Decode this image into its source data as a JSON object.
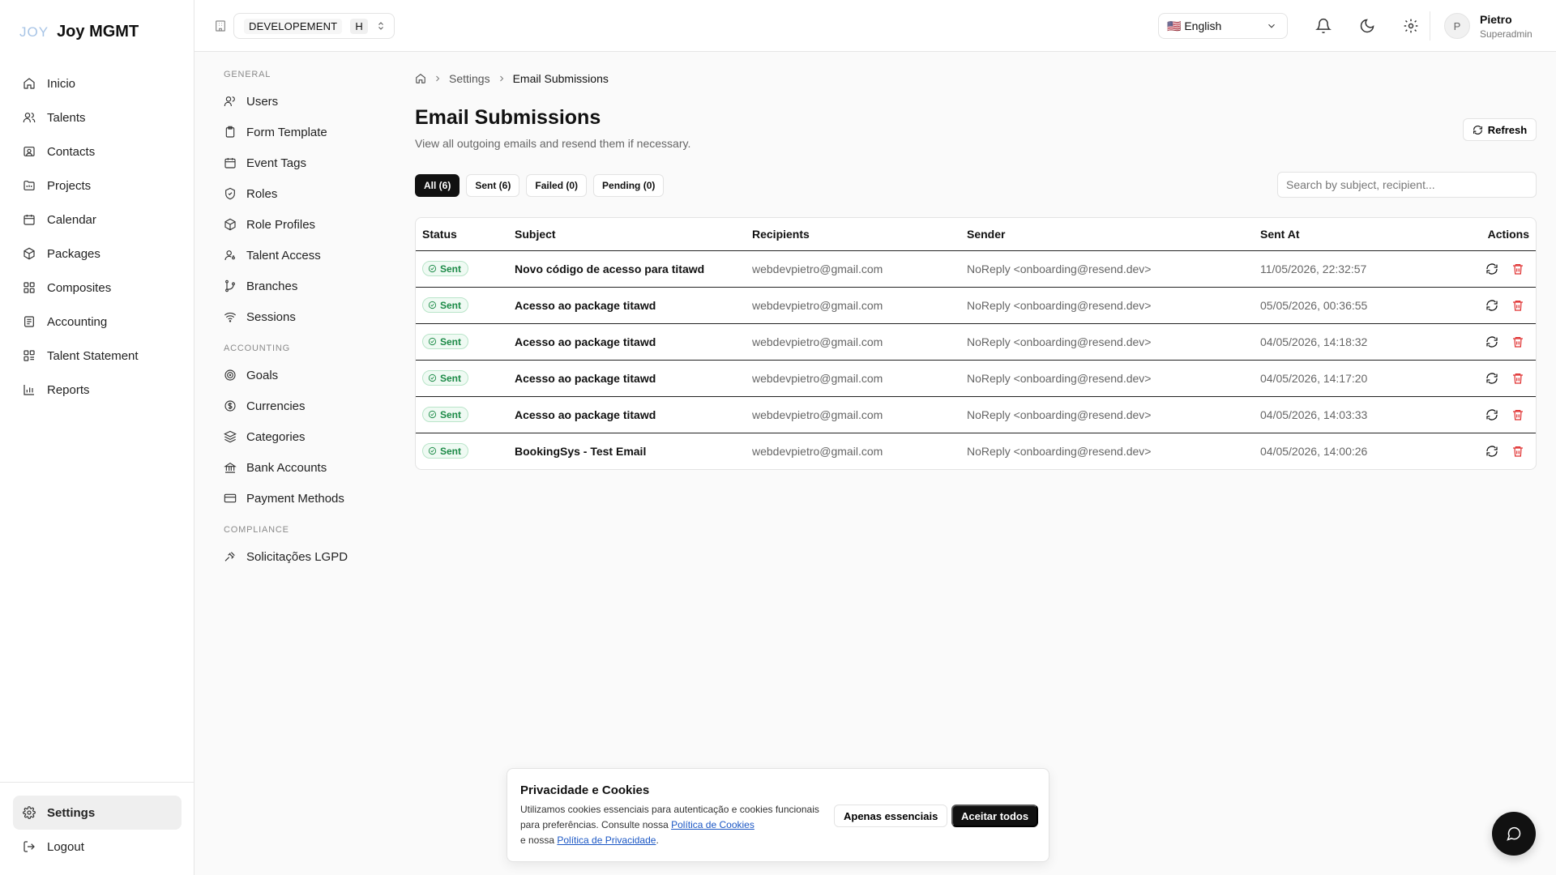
{
  "app": {
    "logo_mark": "JOY",
    "logo_text": "Joy MGMT"
  },
  "nav": {
    "items": [
      {
        "label": "Inicio",
        "icon": "home-icon"
      },
      {
        "label": "Talents",
        "icon": "users-icon"
      },
      {
        "label": "Contacts",
        "icon": "contact-card-icon"
      },
      {
        "label": "Projects",
        "icon": "folder-icon"
      },
      {
        "label": "Calendar",
        "icon": "calendar-icon"
      },
      {
        "label": "Packages",
        "icon": "package-icon"
      },
      {
        "label": "Composites",
        "icon": "grid-icon"
      },
      {
        "label": "Accounting",
        "icon": "ledger-icon"
      },
      {
        "label": "Talent Statement",
        "icon": "statement-icon"
      },
      {
        "label": "Reports",
        "icon": "bar-chart-icon"
      }
    ],
    "settings": "Settings",
    "logout": "Logout"
  },
  "topbar": {
    "environment": "DEVELOPEMENT",
    "environment_short": "H",
    "language": "🇺🇸 English",
    "user_initial": "P",
    "user_name": "Pietro",
    "user_role": "Superadmin"
  },
  "subnav": {
    "general_title": "GENERAL",
    "general": [
      "Users",
      "Form Template",
      "Event Tags",
      "Roles",
      "Role Profiles",
      "Talent Access",
      "Branches",
      "Sessions"
    ],
    "accounting_title": "ACCOUNTING",
    "accounting": [
      "Goals",
      "Currencies",
      "Categories",
      "Bank Accounts",
      "Payment Methods"
    ],
    "compliance_title": "COMPLIANCE",
    "compliance": [
      "Solicitações LGPD"
    ]
  },
  "breadcrumb": {
    "settings": "Settings",
    "current": "Email Submissions"
  },
  "page": {
    "title": "Email Submissions",
    "subtitle": "View all outgoing emails and resend them if necessary.",
    "refresh": "Refresh"
  },
  "filters": [
    "All (6)",
    "Sent (6)",
    "Failed (0)",
    "Pending (0)"
  ],
  "search": {
    "placeholder": "Search by subject, recipient..."
  },
  "table": {
    "headers": [
      "Status",
      "Subject",
      "Recipients",
      "Sender",
      "Sent At",
      "Actions"
    ],
    "rows": [
      {
        "status": "Sent",
        "subject": "Novo código de acesso para titawd",
        "recipients": "webdevpietro@gmail.com",
        "sender": "NoReply <onboarding@resend.dev>",
        "sent_at": "11/05/2026, 22:32:57"
      },
      {
        "status": "Sent",
        "subject": "Acesso ao package titawd",
        "recipients": "webdevpietro@gmail.com",
        "sender": "NoReply <onboarding@resend.dev>",
        "sent_at": "05/05/2026, 00:36:55"
      },
      {
        "status": "Sent",
        "subject": "Acesso ao package titawd",
        "recipients": "webdevpietro@gmail.com",
        "sender": "NoReply <onboarding@resend.dev>",
        "sent_at": "04/05/2026, 14:18:32"
      },
      {
        "status": "Sent",
        "subject": "Acesso ao package titawd",
        "recipients": "webdevpietro@gmail.com",
        "sender": "NoReply <onboarding@resend.dev>",
        "sent_at": "04/05/2026, 14:17:20"
      },
      {
        "status": "Sent",
        "subject": "Acesso ao package titawd",
        "recipients": "webdevpietro@gmail.com",
        "sender": "NoReply <onboarding@resend.dev>",
        "sent_at": "04/05/2026, 14:03:33"
      },
      {
        "status": "Sent",
        "subject": "BookingSys - Test Email",
        "recipients": "webdevpietro@gmail.com",
        "sender": "NoReply <onboarding@resend.dev>",
        "sent_at": "04/05/2026, 14:00:26"
      }
    ]
  },
  "cookie": {
    "title": "Privacidade e Cookies",
    "text_1": "Utilizamos cookies essenciais para autenticação e cookies funcionais para preferências. Consulte nossa ",
    "cookies_link": "Política de Cookies",
    "text_2": " e nossa ",
    "privacy_link": "Política de Privacidade",
    "text_3": ".",
    "essential_button": "Apenas essenciais",
    "accept_button": "Aceitar todos"
  },
  "colors": {
    "success": "#1b8a46",
    "danger": "#e03131",
    "primary": "#111111"
  }
}
